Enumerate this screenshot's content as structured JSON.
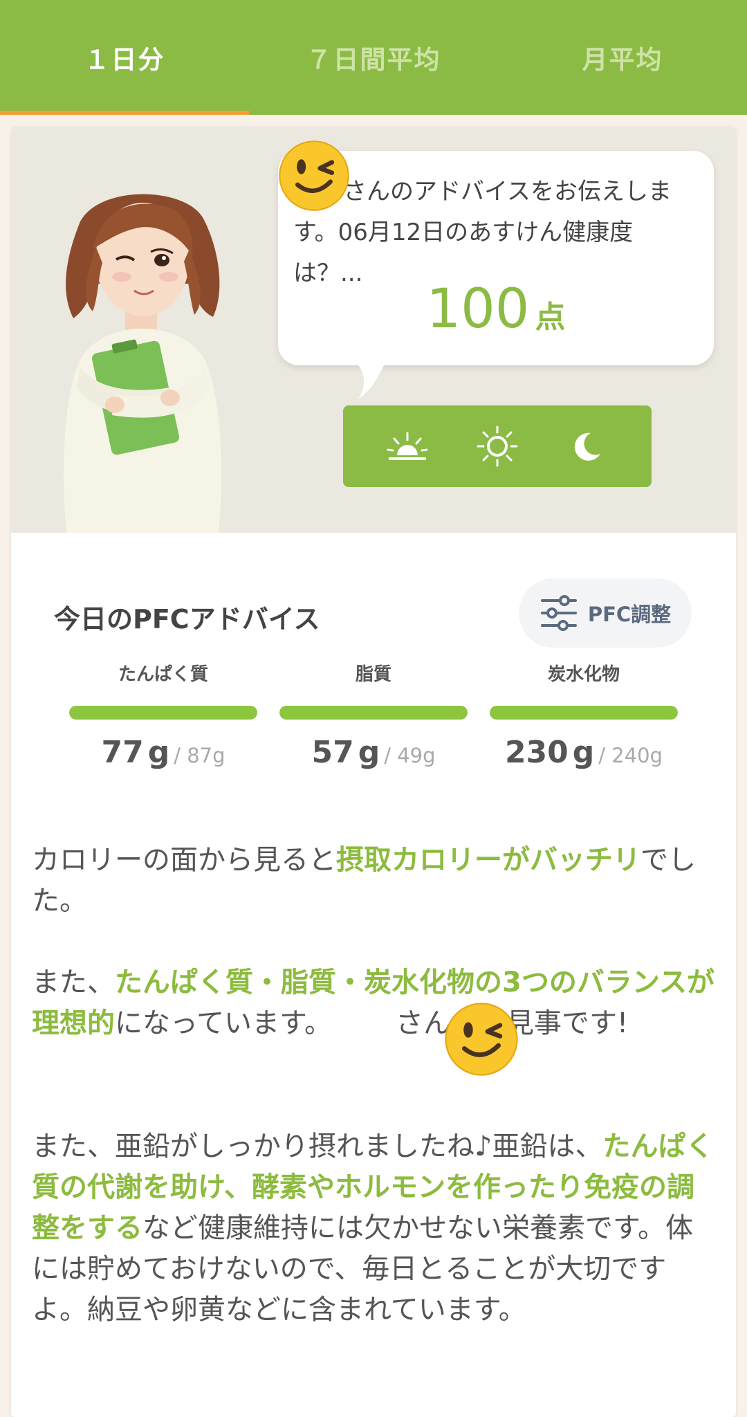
{
  "tabs": [
    {
      "label": "１日分",
      "active": true
    },
    {
      "label": "７日間平均",
      "active": false
    },
    {
      "label": "月平均",
      "active": false
    }
  ],
  "advice_bubble": {
    "text": "さんのアドバイスをお伝えします。06月12日のあすけん健康度は？...",
    "score_value": "100",
    "score_unit": "点"
  },
  "meal_buttons": [
    {
      "icon": "sunrise-icon",
      "name": "breakfast"
    },
    {
      "icon": "sun-icon",
      "name": "lunch"
    },
    {
      "icon": "moon-icon",
      "name": "dinner"
    }
  ],
  "pfc": {
    "title": "今日のPFCアドバイス",
    "adjust_label": "PFC調整",
    "items": [
      {
        "label": "たんぱく質",
        "actual": "77",
        "unit": "g",
        "target": "/ 87g",
        "progress": 1.0
      },
      {
        "label": "脂質",
        "actual": "57",
        "unit": "g",
        "target": "/ 49g",
        "progress": 1.0
      },
      {
        "label": "炭水化物",
        "actual": "230",
        "unit": "g",
        "target": "/ 240g",
        "progress": 1.0
      }
    ]
  },
  "advice": {
    "p1": [
      "カロリーの面から見ると",
      "摂取カロリーがバッチリ",
      "でした。"
    ],
    "p2": [
      "また、",
      "たんぱく質・脂質・炭水化物の3つのバランスが理想的",
      "になっています。",
      "さん、お見事です!"
    ],
    "p3": [
      "また、亜鉛がしっかり摂れましたね♪亜鉛は、",
      "たんぱく質の代謝を助け、酵素やホルモンを作ったり免疫の調整をする",
      "など健康維持には欠かせない栄養素です。体には貯めておけないので、毎日とることが大切ですよ。納豆や卵黄などに含まれています。"
    ]
  },
  "colors": {
    "brand_green": "#8bbb44",
    "tab_indicator": "#f2a03a",
    "highlight_green": "#8cbb3e"
  }
}
